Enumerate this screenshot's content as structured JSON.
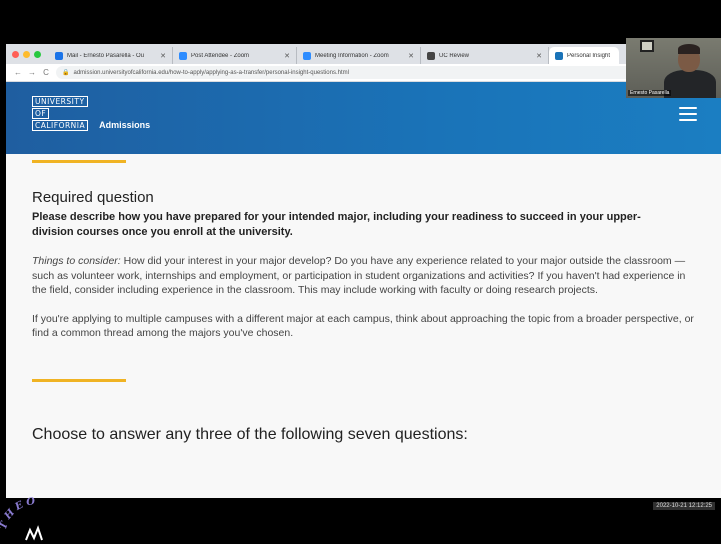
{
  "browser": {
    "traffic_colors": [
      "#ff5f57",
      "#febc2e",
      "#28c840"
    ],
    "tabs": [
      {
        "title": "Mail - Ernesto Pasarella - Ou",
        "icon": "mail-icon",
        "color": "#1a73e8"
      },
      {
        "title": "Post Attendee - Zoom",
        "icon": "zoom-icon",
        "color": "#2d8cff"
      },
      {
        "title": "Meeting Information - Zoom",
        "icon": "zoom-icon",
        "color": "#2d8cff"
      },
      {
        "title": "UC Review",
        "icon": "globe-icon",
        "color": "#444444"
      },
      {
        "title": "Personal Insight",
        "icon": "uc-icon",
        "color": "#1a73b8"
      }
    ],
    "url": "admission.universityofcalifornia.edu/how-to-apply/applying-as-a-transfer/personal-insight-questions.html"
  },
  "site": {
    "logo_lines": [
      "UNIVERSITY",
      "OF",
      "CALIFORNIA"
    ],
    "section": "Admissions",
    "brand_blue": "#1a73b8",
    "accent_gold": "#f0b323"
  },
  "content": {
    "required_heading": "Required question",
    "required_prompt": "Please describe how you have prepared for your intended major, including your readiness to succeed in your upper-division courses once you enroll at the university.",
    "consider_label": "Things to consider:",
    "consider_text": " How did your interest in your major develop? Do you have any experience related to your major outside the classroom — such as volunteer work, internships and employment, or participation in student organizations and activities? If you haven't had experience in the field, consider including experience in the classroom. This may include working with faculty or doing research projects.",
    "multi_campus_text": "If you're applying to multiple campuses with a different major at each campus, think about approaching the topic from a broader perspective, or find a common thread among the majors you've chosen.",
    "choose_heading": "Choose to answer any three of the following seven questions:"
  },
  "overlay": {
    "webcam_label": "Ernesto Pasarella",
    "timestamp": "2022-10-21 12:12:25",
    "seal_text": "THEO"
  }
}
